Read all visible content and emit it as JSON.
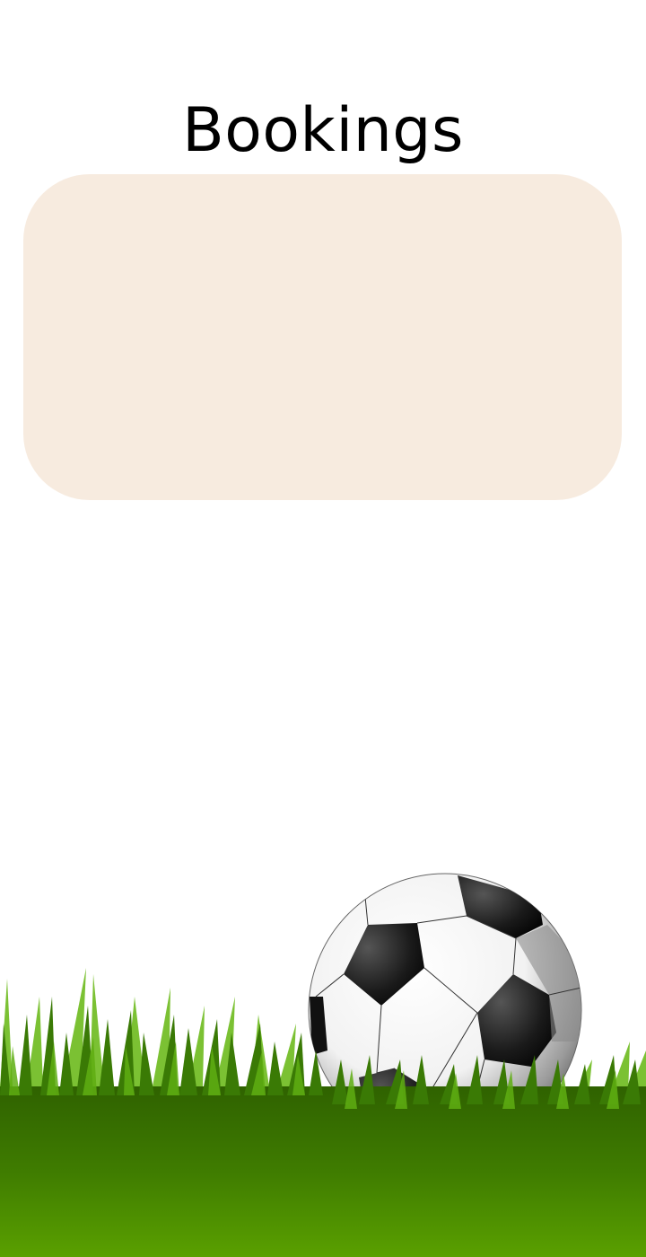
{
  "page": {
    "title": "Bookings"
  },
  "bookings_card": {
    "items": []
  },
  "decoration": {
    "icon": "soccer-ball-on-grass-illustration"
  },
  "colors": {
    "card_background": "#f7ebdf",
    "title_text": "#000000",
    "grass_dark": "#2f6a00",
    "grass_light": "#5aa000"
  }
}
